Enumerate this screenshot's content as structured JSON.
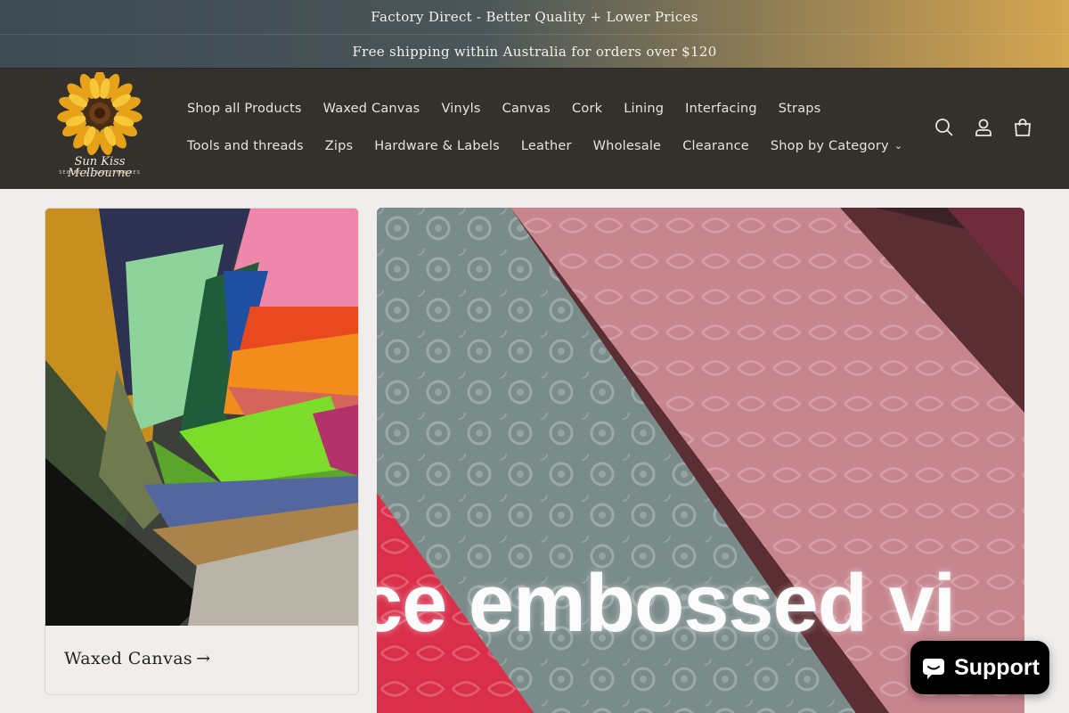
{
  "announcements": [
    "Factory Direct - Better Quality + Lower Prices",
    "Free shipping within Australia for orders over $120"
  ],
  "logo": {
    "text": "Sun Kiss Melbourne",
    "subtitle": "SEWING & CRAFT SUPPLIES"
  },
  "nav": {
    "row1": [
      "Shop all Products",
      "Waxed Canvas",
      "Vinyls",
      "Canvas",
      "Cork",
      "Lining",
      "Interfacing",
      "Straps"
    ],
    "row2": [
      "Tools and threads",
      "Zips",
      "Hardware & Labels",
      "Leather",
      "Wholesale",
      "Clearance",
      "Shop by Category"
    ]
  },
  "header_icons": [
    "search-icon",
    "account-icon",
    "cart-icon"
  ],
  "collections": [
    {
      "title": "Waxed Canvas",
      "arrow": "→"
    }
  ],
  "banner_text": "ce embossed vi",
  "support": {
    "label": "Support",
    "icon": "chat-bubble-icon"
  },
  "colors": {
    "header_bg": "#34302b",
    "page_bg": "#efeeec",
    "support_bg": "#000000"
  }
}
